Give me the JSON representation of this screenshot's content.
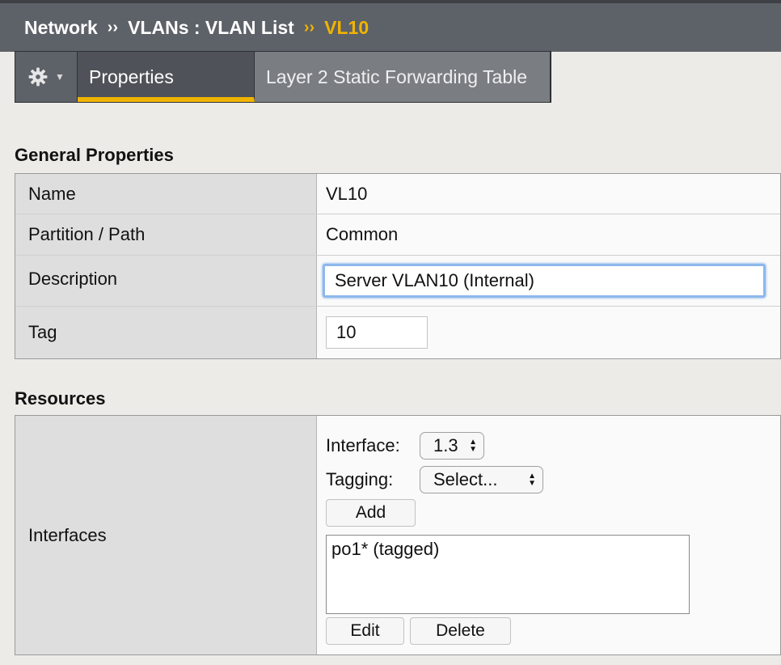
{
  "breadcrumb": {
    "part1": "Network",
    "sep1": "››",
    "part2": "VLANs : VLAN List",
    "sep2": "››",
    "current": "VL10"
  },
  "tabs": {
    "gear_menu": "gear-icon",
    "properties": "Properties",
    "l2_table": "Layer 2 Static Forwarding Table"
  },
  "general": {
    "title": "General Properties",
    "rows": {
      "name": {
        "label": "Name",
        "value": "VL10"
      },
      "partition": {
        "label": "Partition / Path",
        "value": "Common"
      },
      "description": {
        "label": "Description",
        "value": "Server VLAN10 (Internal)"
      },
      "tag": {
        "label": "Tag",
        "value": "10"
      }
    }
  },
  "resources": {
    "title": "Resources",
    "interfaces_label": "Interfaces",
    "interface_field_label": "Interface:",
    "interface_selected": "1.3",
    "tagging_label": "Tagging:",
    "tagging_selected": "Select...",
    "add_button": "Add",
    "list_items": [
      "po1* (tagged)"
    ],
    "edit_button": "Edit",
    "delete_button": "Delete"
  },
  "colors": {
    "accent": "#f0b400",
    "header_bg": "#5d6168",
    "focus_ring": "#8db8ec"
  }
}
